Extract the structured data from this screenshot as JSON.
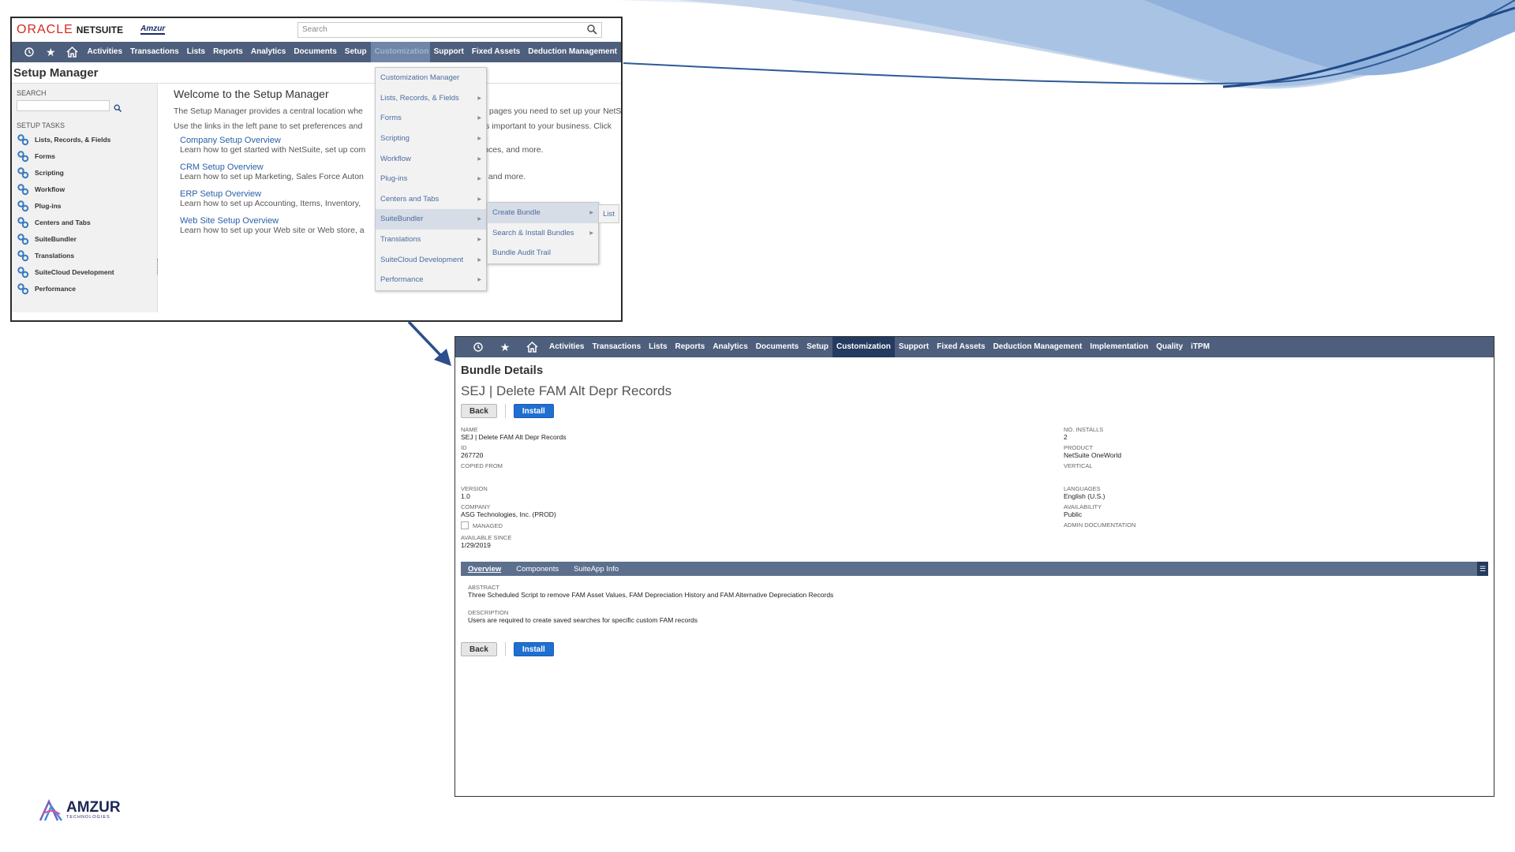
{
  "colors": {
    "nav_bg": "#4d5f7c",
    "nav_active_s2": "#243a5e",
    "link": "#2a62a8",
    "install": "#1f6fd1",
    "oracle_red": "#d32a1f"
  },
  "shot1": {
    "logo_oracle": "ORACLE",
    "logo_netsuite": "NETSUITE",
    "logo_amzur": "Amzur",
    "search_placeholder": "Search",
    "nav": [
      "Activities",
      "Transactions",
      "Lists",
      "Reports",
      "Analytics",
      "Documents",
      "Setup",
      "Customization",
      "Support",
      "Fixed Assets",
      "Deduction Management"
    ],
    "page_title": "Setup Manager",
    "left": {
      "search_label": "SEARCH",
      "tasks_label": "SETUP TASKS",
      "tasks": [
        "Lists, Records, & Fields",
        "Forms",
        "Scripting",
        "Workflow",
        "Plug-ins",
        "Centers and Tabs",
        "SuiteBundler",
        "Translations",
        "SuiteCloud Development",
        "Performance"
      ]
    },
    "main": {
      "heading": "Welcome to the Setup Manager",
      "intro1": "The Setup Manager provides a central location whe",
      "intro1b": "pages you need to set up your NetS",
      "intro2": "Use the links in the left pane to set preferences and",
      "intro2b": "es important to your business. Click",
      "sections": [
        {
          "link": "Company Setup Overview",
          "desc": "Learn how to get started with NetSuite, set up com",
          "tail": "nces, and more."
        },
        {
          "link": "CRM Setup Overview",
          "desc": "Learn how to set up Marketing, Sales Force Auton",
          "tail": "and more."
        },
        {
          "link": "ERP Setup Overview",
          "desc": "Learn how to set up Accounting, Items, Inventory,",
          "tail": ""
        },
        {
          "link": "Web Site Setup Overview",
          "desc": "Learn how to set up your Web site or Web store, a",
          "tail": ""
        }
      ]
    },
    "menu1": [
      "Customization Manager",
      "Lists, Records, & Fields",
      "Forms",
      "Scripting",
      "Workflow",
      "Plug-ins",
      "Centers and Tabs",
      "SuiteBundler",
      "Translations",
      "SuiteCloud Development",
      "Performance"
    ],
    "menu2": [
      "Create Bundle",
      "Search & Install Bundles",
      "Bundle Audit Trail"
    ],
    "menu3": "List"
  },
  "shot2": {
    "nav": [
      "Activities",
      "Transactions",
      "Lists",
      "Reports",
      "Analytics",
      "Documents",
      "Setup",
      "Customization",
      "Support",
      "Fixed Assets",
      "Deduction Management",
      "Implementation",
      "Quality",
      "iTPM"
    ],
    "title": "Bundle Details",
    "bundle_name": "SEJ | Delete FAM Alt Depr Records",
    "back": "Back",
    "install": "Install",
    "left_fields": [
      {
        "label": "NAME",
        "value": "SEJ | Delete FAM Alt Depr Records"
      },
      {
        "label": "ID",
        "value": "267720"
      },
      {
        "label": "COPIED FROM",
        "value": ""
      },
      {
        "label": "VERSION",
        "value": "1.0"
      },
      {
        "label": "COMPANY",
        "value": "ASG Technologies, Inc. (PROD)"
      }
    ],
    "managed_label": "MANAGED",
    "available_since": {
      "label": "AVAILABLE SINCE",
      "value": "1/29/2019"
    },
    "right_fields": [
      {
        "label": "NO. INSTALLS",
        "value": "2"
      },
      {
        "label": "PRODUCT",
        "value": "NetSuite OneWorld"
      },
      {
        "label": "VERTICAL",
        "value": ""
      },
      {
        "label": "LANGUAGES",
        "value": "English (U.S.)"
      },
      {
        "label": "AVAILABILITY",
        "value": "Public"
      },
      {
        "label": "ADMIN DOCUMENTATION",
        "value": ""
      }
    ],
    "subtabs": [
      "Overview",
      "Components",
      "SuiteApp Info"
    ],
    "abstract": {
      "label": "ABSTRACT",
      "value": "Three Scheduled Script to remove FAM Asset Values, FAM Depreciation History and FAM Alternative Depreciation Records"
    },
    "description": {
      "label": "DESCRIPTION",
      "value": "Users are required to create saved searches for specific custom FAM records"
    }
  },
  "footer_logo": {
    "name": "AMZUR",
    "sub": "TECHNOLOGIES"
  }
}
